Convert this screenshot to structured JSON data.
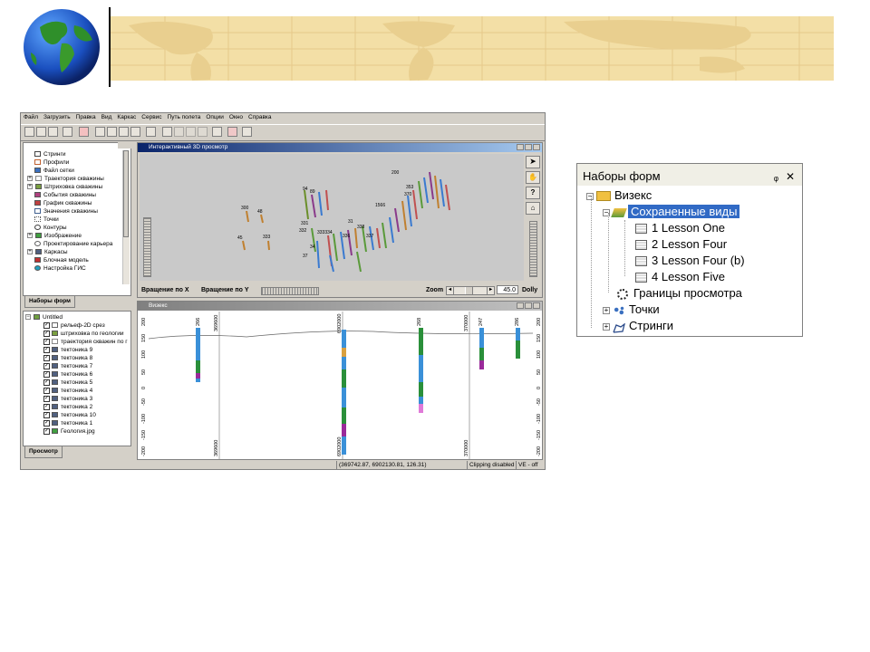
{
  "menu": [
    "Файл",
    "Загрузить",
    "Правка",
    "Вид",
    "Каркас",
    "Сервис",
    "Путь полета",
    "Опции",
    "Окно",
    "Справка"
  ],
  "left_tree_top": {
    "items": [
      "Стринги",
      "Профили",
      "Файл сетки",
      "Траектория скважины",
      "Штриховка скважины",
      "События скважины",
      "График скважины",
      "Значения скважины",
      "Точки",
      "Контуры",
      "Изображение",
      "Проектирование карьера",
      "Каркасы",
      "Блочная модель",
      "Настройка ГИС"
    ],
    "tab_label": "Наборы форм"
  },
  "left_tree_bottom": {
    "root": "Untitled",
    "items": [
      "рельеф-2D срез",
      "штриховка по геологии",
      "траектория скважин по г",
      "тектоника 9",
      "тектоника 8",
      "тектоника 7",
      "тектоника 6",
      "тектоника 5",
      "тектоника 4",
      "тектоника 3",
      "тектоника 2",
      "тектоника 10",
      "тектоника 1",
      "Геология.jpg"
    ],
    "tab_label": "Просмотр"
  },
  "view3d": {
    "title": "Интерактивный 3D просмотр",
    "rot_x": "Вращение по X",
    "rot_y": "Вращение по Y",
    "zoom_label": "Zoom",
    "zoom_value": "45.0",
    "dolly": "Dolly",
    "labels": [
      "300",
      "48",
      "40",
      "45",
      "333",
      "331",
      "332",
      "333334",
      "336",
      "338",
      "337",
      "37",
      "34",
      "31",
      "200",
      "353",
      "370",
      "94",
      "89",
      "1566"
    ]
  },
  "section": {
    "title": "Визекс",
    "left_ticks": [
      "200",
      "150",
      "100",
      "50",
      "0",
      "-50",
      "-100",
      "-150",
      "-200"
    ],
    "right_ticks": [
      "200",
      "150",
      "100",
      "50",
      "0",
      "-50",
      "-100",
      "-150",
      "-200"
    ],
    "top_axis": [
      "369600",
      "6902000",
      "370000"
    ],
    "bottom_axis": [
      "369600",
      "6902000",
      "370000"
    ],
    "hole_labels": [
      "266",
      "268",
      "247",
      "286"
    ]
  },
  "statusbar": {
    "coords": "(369742.87, 6902130.81, 126.31)",
    "clipping": "Clipping disabled",
    "ve": "VE - off"
  },
  "forms_panel": {
    "title": "Наборы форм",
    "pin": "ᵩ",
    "close": "✕",
    "root": "Визекс",
    "saved_views": "Сохраненные виды",
    "views": [
      "1 Lesson One",
      "2 Lesson Four",
      "3 Lesson Four (b)",
      "4 Lesson Five"
    ],
    "bounds": "Границы просмотра",
    "points": "Точки",
    "strings": "Стринги"
  },
  "colors": {
    "accent_blue": "#316ac5",
    "titlebar": "#0a246a",
    "map_bg": "#f3dfa6"
  }
}
